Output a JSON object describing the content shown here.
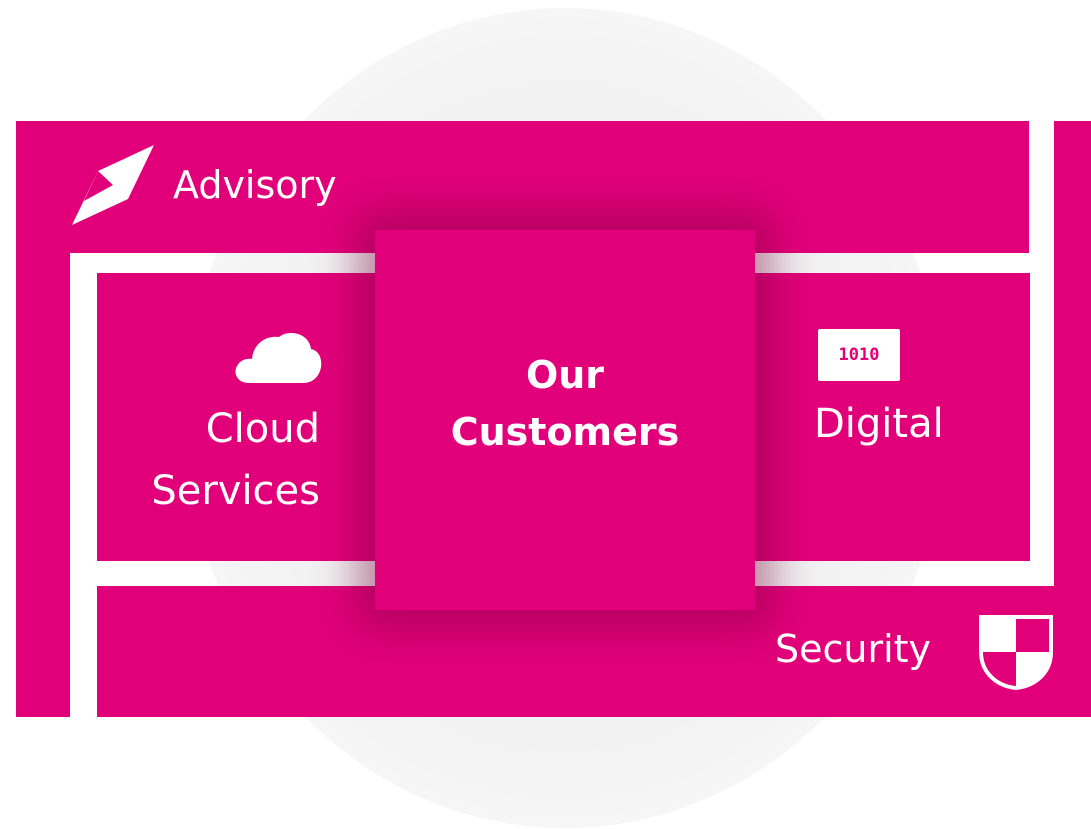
{
  "advisory": {
    "label": "Advisory",
    "icon": "compass-icon"
  },
  "cloud": {
    "line1": "Cloud",
    "line2": "Services",
    "icon": "cloud-icon"
  },
  "digital": {
    "label": "Digital",
    "badge": "1010",
    "icon": "binary-icon"
  },
  "security": {
    "label": "Security",
    "icon": "shield-icon"
  },
  "center": {
    "line1": "Our",
    "line2": "Customers"
  },
  "colors": {
    "magenta": "#e2007a",
    "background": "#ffffff"
  }
}
